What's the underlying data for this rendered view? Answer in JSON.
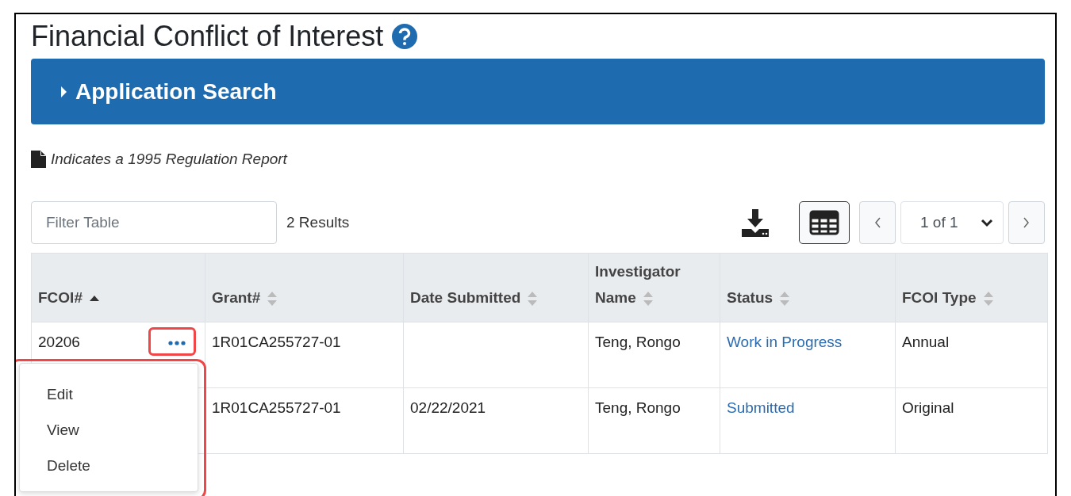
{
  "page": {
    "title": "Financial Conflict of Interest"
  },
  "search_panel": {
    "label": "Application Search",
    "expanded": false
  },
  "legend": {
    "text": "Indicates a 1995 Regulation Report"
  },
  "toolbar": {
    "filter": {
      "placeholder": "Filter Table"
    },
    "results": "2 Results",
    "pager": {
      "value": "1 of 1"
    }
  },
  "table": {
    "columns": [
      {
        "label": "FCOI#",
        "sorted": true
      },
      {
        "label": "Grant#",
        "sorted": false
      },
      {
        "label": "Date Submitted",
        "sorted": false
      },
      {
        "label": "Investigator Name",
        "sorted": false
      },
      {
        "label": "Status",
        "sorted": false,
        "kind": "link"
      },
      {
        "label": "FCOI Type",
        "sorted": false
      }
    ],
    "rows": [
      {
        "cells": [
          "20206",
          "1R01CA255727-01",
          "",
          "Teng, Rongo",
          "Work in Progress",
          "Annual"
        ],
        "actions": {
          "expanded": true
        }
      },
      {
        "cells": [
          "",
          "1R01CA255727-01",
          "02/22/2021",
          "Teng, Rongo",
          "Submitted",
          "Original"
        ]
      }
    ]
  },
  "action_menu": {
    "items": [
      "Edit",
      "View",
      "Delete"
    ]
  }
}
